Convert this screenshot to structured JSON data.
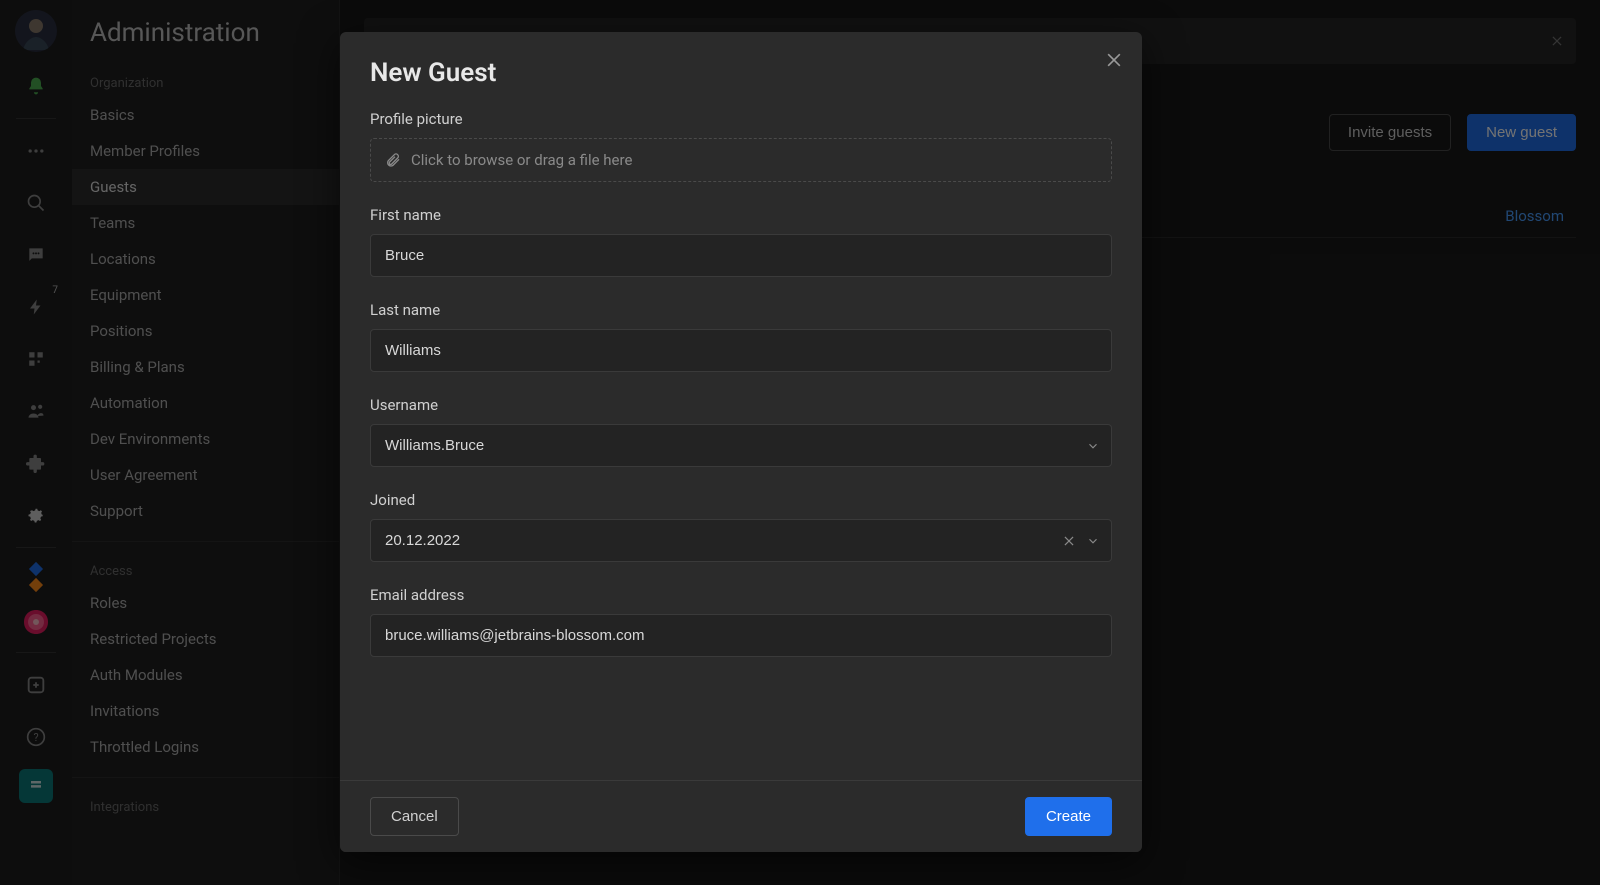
{
  "rail": {
    "bolt_badge": "7"
  },
  "sidebar": {
    "title": "Administration",
    "groups": [
      {
        "label": "Organization",
        "items": [
          "Basics",
          "Member Profiles",
          "Guests",
          "Teams",
          "Locations",
          "Equipment",
          "Positions",
          "Billing & Plans",
          "Automation",
          "Dev Environments",
          "User Agreement",
          "Support"
        ],
        "active_index": 2
      },
      {
        "label": "Access",
        "items": [
          "Roles",
          "Restricted Projects",
          "Auth Modules",
          "Invitations",
          "Throttled Logins"
        ]
      },
      {
        "label": "Integrations",
        "items": []
      }
    ]
  },
  "main": {
    "buttons": {
      "invite": "Invite guests",
      "new_guest": "New guest"
    },
    "row_link": "Blossom"
  },
  "modal": {
    "title": "New Guest",
    "fields": {
      "profile_picture": {
        "label": "Profile picture",
        "placeholder": "Click to browse or drag a file here"
      },
      "first_name": {
        "label": "First name",
        "value": "Bruce"
      },
      "last_name": {
        "label": "Last name",
        "value": "Williams"
      },
      "username": {
        "label": "Username",
        "value": "Williams.Bruce"
      },
      "joined": {
        "label": "Joined",
        "value": "20.12.2022"
      },
      "email": {
        "label": "Email address",
        "value": "bruce.williams@jetbrains-blossom.com"
      }
    },
    "footer": {
      "cancel": "Cancel",
      "create": "Create"
    }
  }
}
